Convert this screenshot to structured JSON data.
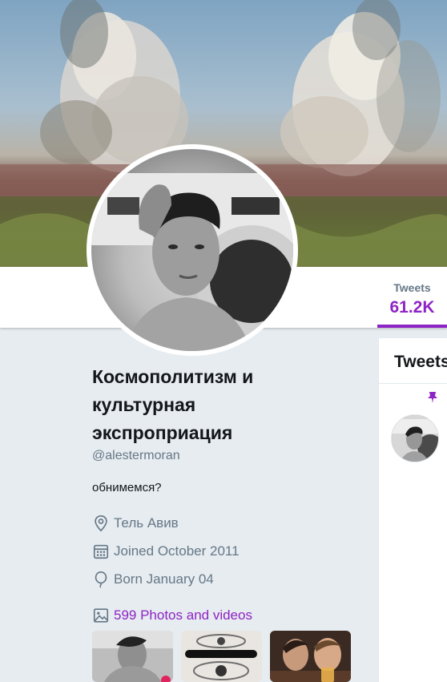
{
  "nav": {
    "tweets_label": "Tweets",
    "tweets_value": "61.2K"
  },
  "profile": {
    "name": "Космополитизм и культурная экспроприация",
    "handle": "@alestermoran",
    "bio": "обнимемся?",
    "location": "Тель Авив",
    "joined": "Joined October 2011",
    "born": "Born January 04",
    "photos_link": "599 Photos and videos"
  },
  "timeline": {
    "header": "Tweets"
  },
  "icons": {
    "location": "location-pin-icon",
    "calendar": "calendar-icon",
    "balloon": "balloon-icon",
    "photo": "photo-icon",
    "pin": "pin-icon"
  },
  "colors": {
    "accent": "#8e24c4",
    "secondary_text": "#657786",
    "background": "#e6ecf0"
  }
}
